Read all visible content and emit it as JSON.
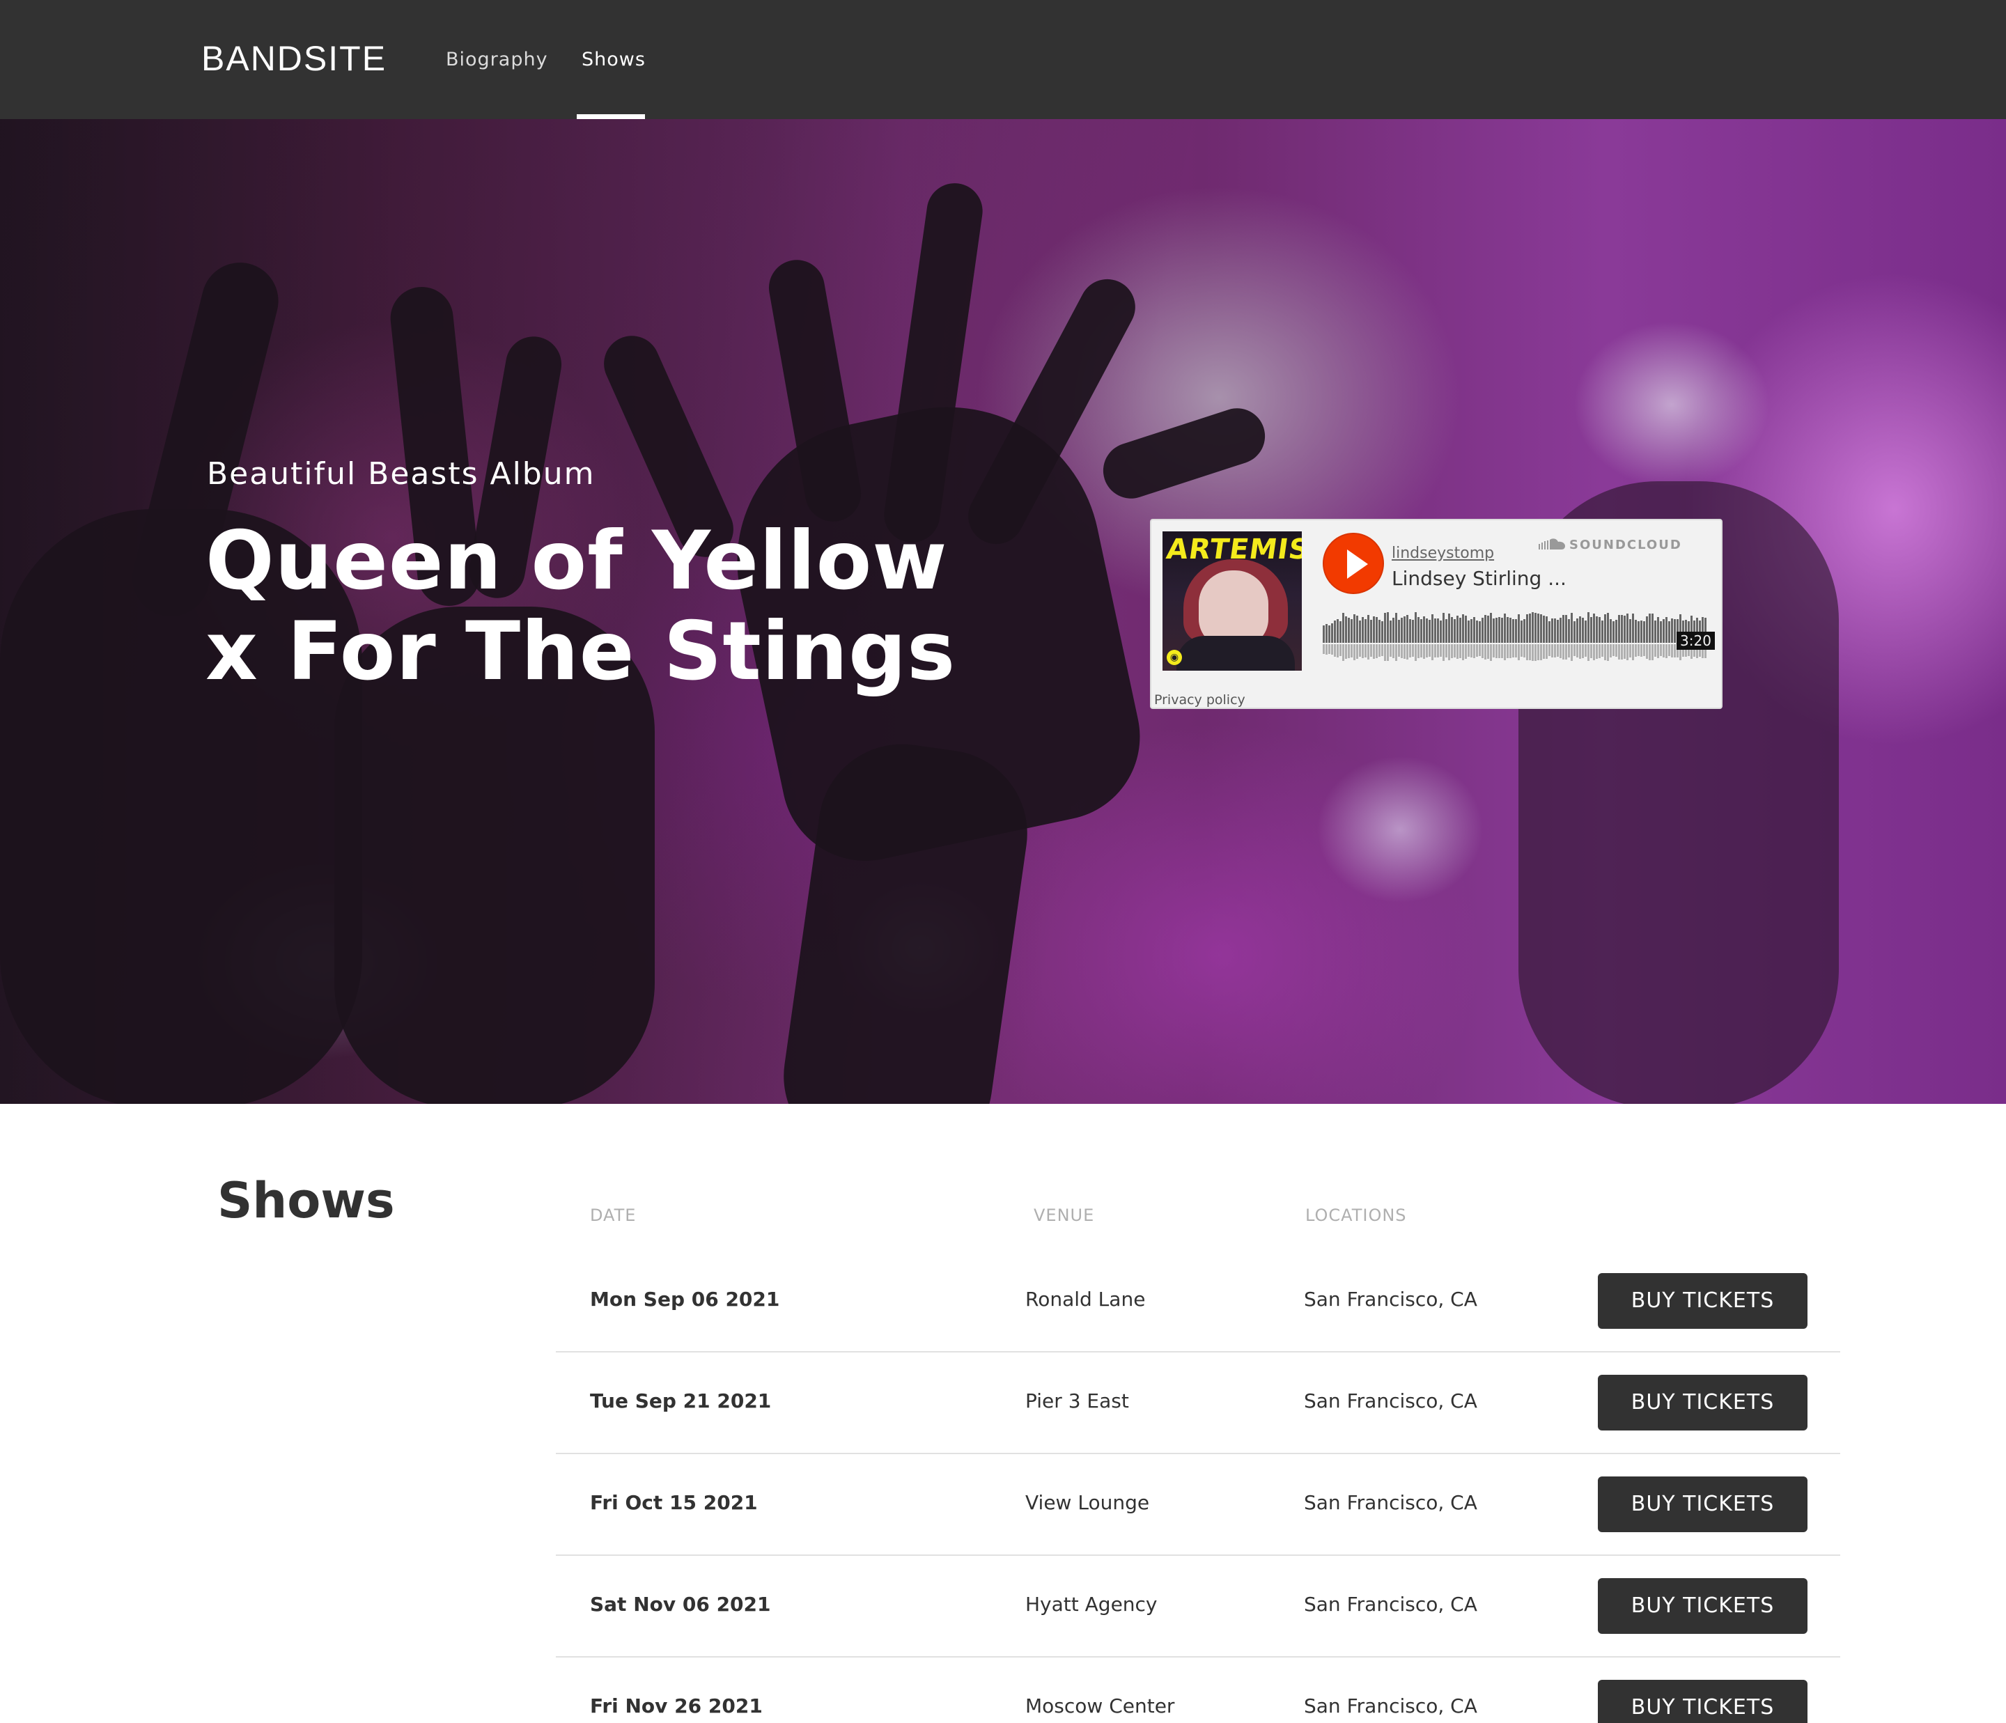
{
  "nav": {
    "logo": "BANDSITE",
    "links": [
      {
        "label": "Biography",
        "active": false
      },
      {
        "label": "Shows",
        "active": true
      }
    ]
  },
  "hero": {
    "subtitle": "Beautiful Beasts Album",
    "title_line1": "Queen of Yellow",
    "title_line2": "x For The Stings"
  },
  "soundcloud": {
    "artwork_title": "ARTEMIS",
    "user": "lindseystomp",
    "track": "Lindsey Stirling ...",
    "brand": "SOUNDCLOUD",
    "duration": "3:20",
    "privacy": "Privacy policy",
    "play_color": "#f23a00"
  },
  "shows": {
    "heading": "Shows",
    "columns": {
      "date": "DATE",
      "venue": "VENUE",
      "location": "LOCATIONS"
    },
    "rows": [
      {
        "date": "Mon Sep 06 2021",
        "venue": "Ronald Lane",
        "location": "San Francisco, CA",
        "button": "BUY TICKETS"
      },
      {
        "date": "Tue Sep 21 2021",
        "venue": "Pier 3 East",
        "location": "San Francisco, CA",
        "button": "BUY TICKETS"
      },
      {
        "date": "Fri Oct 15 2021",
        "venue": "View Lounge",
        "location": "San Francisco, CA",
        "button": "BUY TICKETS"
      },
      {
        "date": "Sat Nov 06 2021",
        "venue": "Hyatt Agency",
        "location": "San Francisco, CA",
        "button": "BUY TICKETS"
      },
      {
        "date": "Fri Nov 26 2021",
        "venue": "Moscow Center",
        "location": "San Francisco, CA",
        "button": "BUY TICKETS"
      }
    ]
  },
  "colors": {
    "nav_bg": "#323232",
    "button_bg": "#323232",
    "divider": "#e1e1e1",
    "column_header": "#afafaf"
  }
}
